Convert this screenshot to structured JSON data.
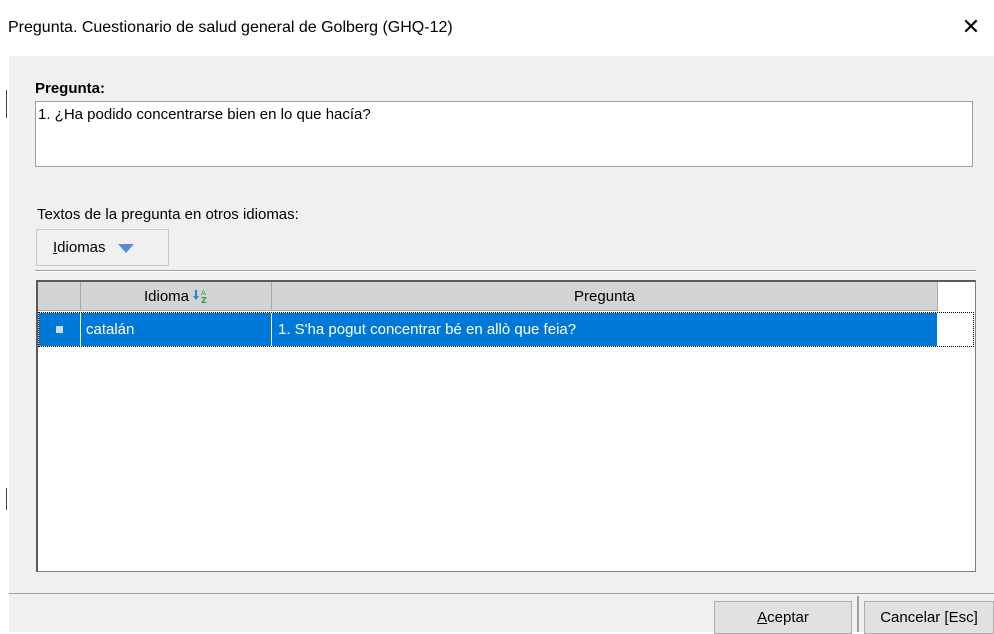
{
  "window": {
    "title": "Pregunta. Cuestionario de salud general de Golberg (GHQ-12)",
    "close_glyph": "✕"
  },
  "question": {
    "label": "Pregunta:",
    "text": "1. ¿Ha podido concentrarse bien en lo que hacía?"
  },
  "translations": {
    "label": "Textos de la pregunta en otros idiomas:",
    "dropdown_button": {
      "accel": "I",
      "rest": "diomas",
      "icon": "triangle-down-icon"
    },
    "grid": {
      "columns": [
        "Idioma",
        "Pregunta"
      ],
      "sort_icon": "sort-az-icon",
      "rows": [
        {
          "idioma": "catalán",
          "pregunta": "1. S'ha pogut concentrar bé en allò que feia?"
        }
      ]
    }
  },
  "footer": {
    "ok": {
      "accel": "A",
      "rest": "ceptar"
    },
    "cancel": {
      "text": "Cancelar [Esc]"
    }
  },
  "colors": {
    "selection": "#0078d7",
    "header": "#d4d4d4",
    "dialog_bg": "#f0f0f0"
  }
}
